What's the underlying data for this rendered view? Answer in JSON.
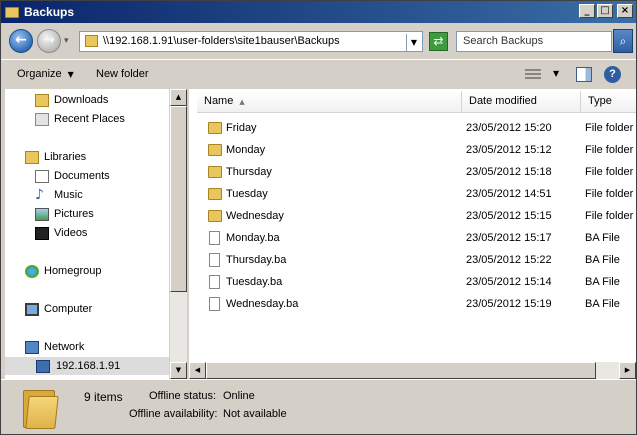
{
  "window": {
    "title": "Backups",
    "controls": [
      "minimize-icon",
      "maximize-icon",
      "close-icon"
    ]
  },
  "address_bar": {
    "path": "\\\\192.168.1.91\\user-folders\\site1bauser\\Backups",
    "search_placeholder": "Search Backups"
  },
  "toolbar": {
    "organize_label": "Organize",
    "new_folder_label": "New folder"
  },
  "nav_pane": {
    "favorites": [
      {
        "label": "Downloads",
        "icon": "downloads-icon"
      },
      {
        "label": "Recent Places",
        "icon": "recent-places-icon"
      }
    ],
    "libraries": {
      "label": "Libraries",
      "items": [
        {
          "label": "Documents",
          "icon": "documents-icon"
        },
        {
          "label": "Music",
          "icon": "music-icon"
        },
        {
          "label": "Pictures",
          "icon": "pictures-icon"
        },
        {
          "label": "Videos",
          "icon": "videos-icon"
        }
      ]
    },
    "homegroup": "Homegroup",
    "computer": "Computer",
    "network": "Network",
    "network_host": "192.168.1.91"
  },
  "file_list": {
    "columns": [
      "Name",
      "Date modified",
      "Type"
    ],
    "rows": [
      {
        "name": "Friday",
        "date": "23/05/2012 15:20",
        "type": "File folder",
        "kind": "folder"
      },
      {
        "name": "Monday",
        "date": "23/05/2012 15:12",
        "type": "File folder",
        "kind": "folder"
      },
      {
        "name": "Thursday",
        "date": "23/05/2012 15:18",
        "type": "File folder",
        "kind": "folder"
      },
      {
        "name": "Tuesday",
        "date": "23/05/2012 14:51",
        "type": "File folder",
        "kind": "folder"
      },
      {
        "name": "Wednesday",
        "date": "23/05/2012 15:15",
        "type": "File folder",
        "kind": "folder"
      },
      {
        "name": "Monday.ba",
        "date": "23/05/2012 15:17",
        "type": "BA File",
        "kind": "file"
      },
      {
        "name": "Thursday.ba",
        "date": "23/05/2012 15:22",
        "type": "BA File",
        "kind": "file"
      },
      {
        "name": "Tuesday.ba",
        "date": "23/05/2012 15:14",
        "type": "BA File",
        "kind": "file"
      },
      {
        "name": "Wednesday.ba",
        "date": "23/05/2012 15:19",
        "type": "BA File",
        "kind": "file"
      }
    ]
  },
  "details_pane": {
    "item_count": "9 items",
    "offline_status_label": "Offline status:",
    "offline_status_value": "Online",
    "offline_availability_label": "Offline availability:",
    "offline_availability_value": "Not available"
  },
  "colors": {
    "title_bar": "#0a246a",
    "window_face": "#d4d0c8",
    "folder": "#e9c65e"
  }
}
